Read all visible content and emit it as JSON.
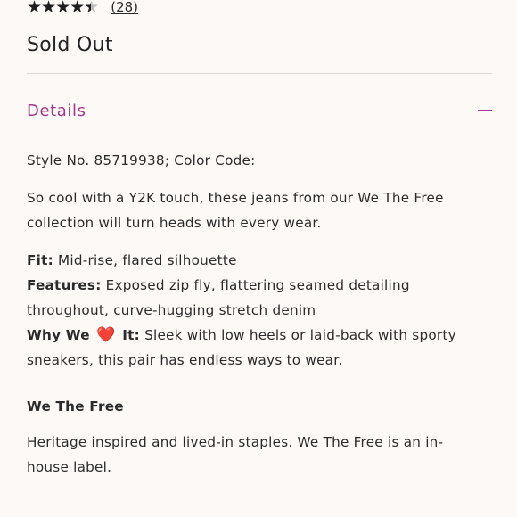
{
  "rating": {
    "review_count": "(28)",
    "stars_icon": "star-icon"
  },
  "status": {
    "sold_out": "Sold Out"
  },
  "details": {
    "title": "Details",
    "toggle_icon": "minus-icon",
    "style_line": "Style No. 85719938; Color Code:",
    "description": "So cool with a Y2K touch, these jeans from our We The Free collection will turn heads with every wear.",
    "fit_label": "Fit:",
    "fit_value": " Mid-rise, flared silhouette",
    "features_label": "Features:",
    "features_value": " Exposed zip fly, flattering seamed detailing throughout, curve-hugging stretch denim",
    "why_label_before": "Why We ",
    "why_heart": "❤️",
    "why_label_after": " It:",
    "why_value": " Sleek with low heels or laid-back with sporty sneakers, this pair has endless ways to wear.",
    "brand_heading": "We The Free",
    "brand_text": "Heritage inspired and lived-in staples. We The Free is an in-house label."
  },
  "colors": {
    "accent": "#a2388d",
    "background": "#fdf9f6",
    "heart": "#e0262f"
  }
}
